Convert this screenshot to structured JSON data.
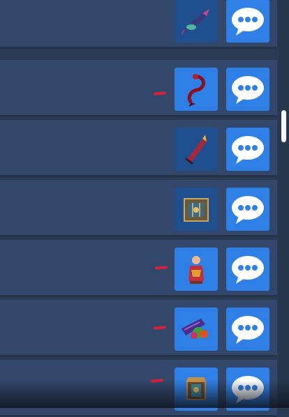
{
  "rows": [
    {
      "item_icon": "quill-item-icon",
      "slot_style": "dark",
      "marked": false
    },
    {
      "item_icon": "red-whip-item-icon",
      "slot_style": "bright",
      "marked": true
    },
    {
      "item_icon": "red-dagger-item-icon",
      "slot_style": "dark",
      "marked": false
    },
    {
      "item_icon": "cage-item-icon",
      "slot_style": "dark",
      "marked": false
    },
    {
      "item_icon": "figurine-item-icon",
      "slot_style": "bright",
      "marked": true
    },
    {
      "item_icon": "potion-bundle-item-icon",
      "slot_style": "bright",
      "marked": true
    },
    {
      "item_icon": "lantern-item-icon",
      "slot_style": "bright",
      "marked": true
    }
  ],
  "chat_icon": "speech-bubble-icon",
  "colors": {
    "row_bg": "#33476a",
    "slot_dark": "#1f4f8f",
    "slot_bright": "#2f80e6",
    "marker_red": "#d8203a"
  }
}
